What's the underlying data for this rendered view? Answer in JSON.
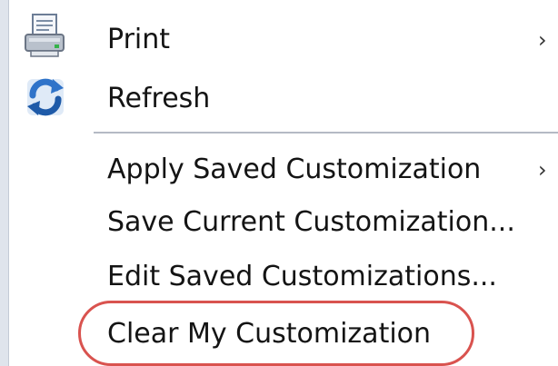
{
  "menu": {
    "items": [
      {
        "label": "Print",
        "icon": "printer-icon",
        "submenu": true
      },
      {
        "label": "Refresh",
        "icon": "refresh-icon",
        "submenu": false
      },
      {
        "label": "Apply Saved Customization",
        "submenu": true
      },
      {
        "label": "Save Current Customization...",
        "submenu": false
      },
      {
        "label": "Edit Saved Customizations...",
        "submenu": false
      },
      {
        "label": "Clear My Customization",
        "submenu": false,
        "highlighted": true
      }
    ],
    "submenu_arrow": "›"
  },
  "colors": {
    "text": "#141414",
    "highlight": "#d9534f",
    "separator": "#b4bac4"
  }
}
